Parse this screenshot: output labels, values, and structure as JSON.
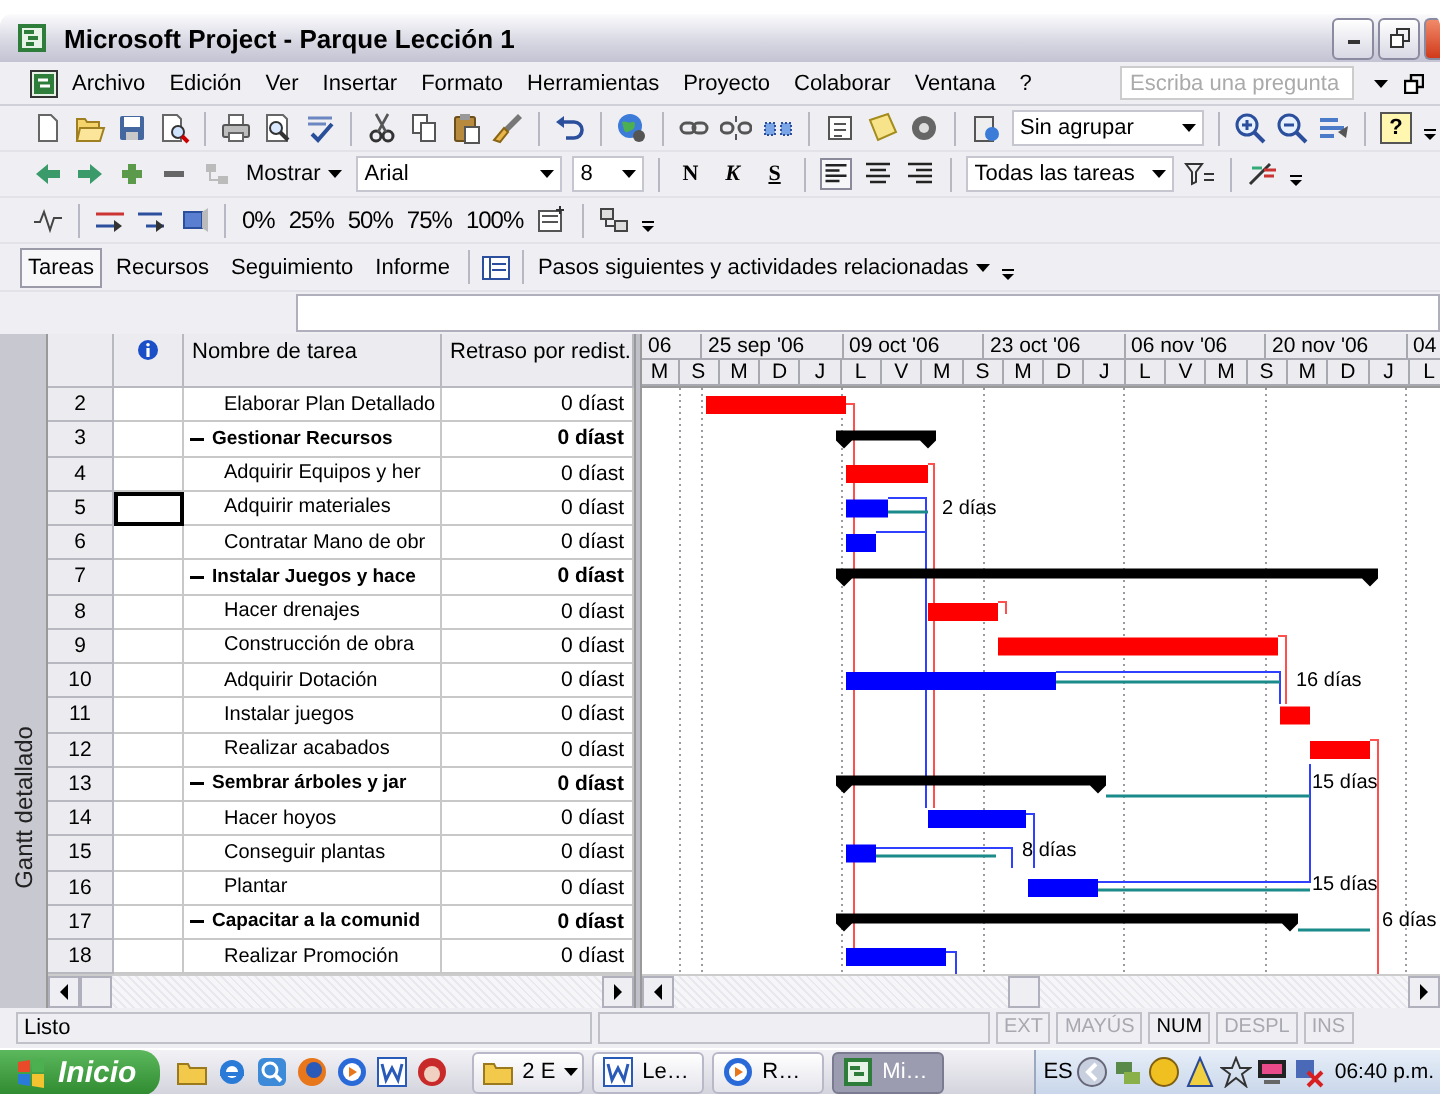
{
  "window": {
    "title": "Microsoft Project - Parque Lección 1"
  },
  "menu": [
    "Archivo",
    "Edición",
    "Ver",
    "Insertar",
    "Formato",
    "Herramientas",
    "Proyecto",
    "Colaborar",
    "Ventana",
    "?"
  ],
  "help_box": {
    "placeholder": "Escriba una pregunta"
  },
  "standard_toolbar": {
    "group_dropdown": "Sin agrupar",
    "help_button": "?"
  },
  "formatting_toolbar": {
    "show_button": "Mostrar",
    "font": "Arial",
    "size": "8",
    "bold": "N",
    "italic": "K",
    "underline": "S",
    "filter": "Todas las tareas"
  },
  "tracking_toolbar": {
    "percent_buttons": [
      "0%",
      "25%",
      "50%",
      "75%",
      "100%"
    ]
  },
  "view_bar": {
    "tabs": [
      {
        "label": "Tareas",
        "selected": true
      },
      {
        "label": "Recursos",
        "selected": false
      },
      {
        "label": "Seguimiento",
        "selected": false
      },
      {
        "label": "Informe",
        "selected": false
      }
    ],
    "guide": "Pasos siguientes y actividades relacionadas"
  },
  "side_label": "Gantt detallado",
  "table": {
    "columns": [
      "Nombre de tarea",
      "Retraso por redist."
    ],
    "rows": [
      {
        "id": "2",
        "name": "Elaborar Plan Detallado",
        "delay": "0 díast",
        "kind": "task",
        "critical": true,
        "selected": false
      },
      {
        "id": "3",
        "name": "Gestionar Recursos",
        "delay": "0 díast",
        "kind": "summary",
        "selected": false
      },
      {
        "id": "4",
        "name": "Adquirir Equipos y her",
        "delay": "0 díast",
        "kind": "task",
        "critical": true,
        "selected": false
      },
      {
        "id": "5",
        "name": "Adquirir materiales",
        "delay": "0 díast",
        "kind": "task",
        "critical": false,
        "selected": true
      },
      {
        "id": "6",
        "name": "Contratar Mano de obr",
        "delay": "0 díast",
        "kind": "task",
        "critical": false,
        "selected": false
      },
      {
        "id": "7",
        "name": "Instalar Juegos y hace",
        "delay": "0 díast",
        "kind": "summary",
        "selected": false
      },
      {
        "id": "8",
        "name": "Hacer drenajes",
        "delay": "0 díast",
        "kind": "task",
        "critical": true,
        "selected": false
      },
      {
        "id": "9",
        "name": "Construcción de obra",
        "delay": "0 díast",
        "kind": "task",
        "critical": true,
        "selected": false
      },
      {
        "id": "10",
        "name": "Adquirir Dotación",
        "delay": "0 díast",
        "kind": "task",
        "critical": false,
        "selected": false
      },
      {
        "id": "11",
        "name": "Instalar juegos",
        "delay": "0 díast",
        "kind": "task",
        "critical": true,
        "selected": false
      },
      {
        "id": "12",
        "name": "Realizar acabados",
        "delay": "0 díast",
        "kind": "task",
        "critical": true,
        "selected": false
      },
      {
        "id": "13",
        "name": "Sembrar árboles y jar",
        "delay": "0 díast",
        "kind": "summary",
        "selected": false
      },
      {
        "id": "14",
        "name": "Hacer hoyos",
        "delay": "0 díast",
        "kind": "task",
        "critical": false,
        "selected": false
      },
      {
        "id": "15",
        "name": "Conseguir plantas",
        "delay": "0 díast",
        "kind": "task",
        "critical": false,
        "selected": false
      },
      {
        "id": "16",
        "name": "Plantar",
        "delay": "0 díast",
        "kind": "task",
        "critical": false,
        "selected": false
      },
      {
        "id": "17",
        "name": "Capacitar a la comunid",
        "delay": "0 díast",
        "kind": "summary",
        "selected": false
      },
      {
        "id": "18",
        "name": "Realizar Promoción",
        "delay": "0 díast",
        "kind": "task",
        "critical": false,
        "selected": false
      }
    ]
  },
  "timescale": {
    "major": [
      "06",
      "25 sep '06",
      "09 oct '06",
      "23 oct '06",
      "06 nov '06",
      "20 nov '06",
      "04"
    ],
    "minor": [
      "M",
      "S",
      "M",
      "D",
      "J",
      "L",
      "V",
      "M",
      "S",
      "M",
      "D",
      "J",
      "L",
      "V",
      "M",
      "S",
      "M",
      "D",
      "J",
      "L"
    ]
  },
  "slack_labels": [
    "2 días",
    "16 días",
    "15 días",
    "8 días",
    "15 días",
    "6 días"
  ],
  "status_bar": {
    "text": "Listo",
    "indicators": [
      {
        "label": "EXT",
        "on": false
      },
      {
        "label": "MAYÚS",
        "on": false
      },
      {
        "label": "NUM",
        "on": true
      },
      {
        "label": "DESPL",
        "on": false
      },
      {
        "label": "INS",
        "on": false
      }
    ]
  },
  "taskbar": {
    "start": "Inicio",
    "tasks": [
      {
        "label": "2 E",
        "selected": false
      },
      {
        "label": "Le…",
        "selected": false
      },
      {
        "label": "R…",
        "selected": false
      },
      {
        "label": "Mi…",
        "selected": true
      }
    ],
    "language": "ES",
    "clock": "06:40 p.m."
  }
}
